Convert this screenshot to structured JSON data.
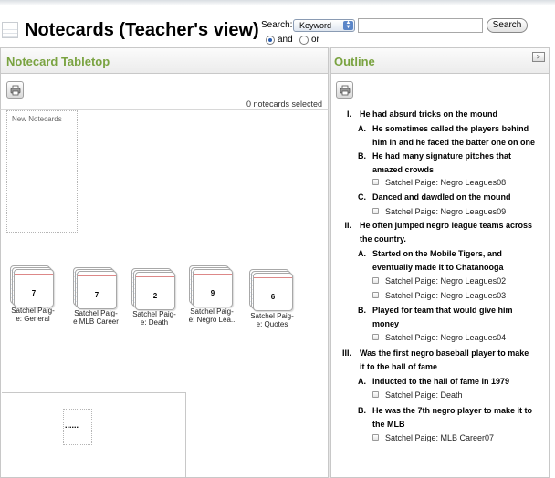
{
  "header": {
    "title": "Notecards (Teacher's view)"
  },
  "search": {
    "label": "Search:",
    "field_value": "Keyword",
    "input_value": "",
    "button_label": "Search",
    "mode_and": "and",
    "mode_or": "or",
    "selected_mode": "and"
  },
  "tabletop": {
    "title": "Notecard Tabletop",
    "selected_count": "0 notecards selected",
    "new_notecards_label": "New Notecards",
    "stacks": [
      {
        "count": "7",
        "caption_line1": "Satchel Paig-",
        "caption_line2": "e: General"
      },
      {
        "count": "7",
        "caption_line1": "Satchel Paig-",
        "caption_line2": "e MLB Career"
      },
      {
        "count": "2",
        "caption_line1": "Satchel Paig-",
        "caption_line2": "e: Death"
      },
      {
        "count": "9",
        "caption_line1": "Satchel Paig-",
        "caption_line2": "e: Negro Lea.."
      },
      {
        "count": "6",
        "caption_line1": "Satchel Paig-",
        "caption_line2": "e: Quotes"
      }
    ],
    "drop_placeholder": "......"
  },
  "outline": {
    "title": "Outline",
    "collapse_glyph": ">",
    "items": [
      {
        "num": "I.",
        "line1": "He had absurd tricks on the mound"
      },
      {
        "num": "A.",
        "line1": "He sometimes called the players behind",
        "line2": "him in and he faced the batter one on one"
      },
      {
        "num": "B.",
        "line1": "He had many signature pitches that",
        "line2": "amazed crowds"
      },
      {
        "note": "Satchel Paige: Negro Leagues08"
      },
      {
        "num": "C.",
        "line1": "Danced and dawdled on the mound"
      },
      {
        "note": "Satchel Paige: Negro Leagues09"
      },
      {
        "num": "II.",
        "line1": "He often jumped negro league teams across",
        "line2": "the country."
      },
      {
        "num": "A.",
        "line1": "Started on the Mobile Tigers, and",
        "line2": "eventually made it to Chatanooga"
      },
      {
        "note": "Satchel Paige: Negro Leagues02"
      },
      {
        "note": "Satchel Paige: Negro Leagues03"
      },
      {
        "num": "B.",
        "line1": "Played for team that would give him",
        "line2": "money"
      },
      {
        "note": "Satchel Paige: Negro Leagues04"
      },
      {
        "num": "III.",
        "line1": "Was the first negro baseball player to make",
        "line2": "it to the hall of fame"
      },
      {
        "num": "A.",
        "line1": "Inducted to the hall of fame in 1979"
      },
      {
        "note": "Satchel Paige: Death"
      },
      {
        "num": "B.",
        "line1": "He was the 7th negro player to make it to",
        "line2": "the MLB"
      },
      {
        "note": "Satchel Paige: MLB Career07"
      }
    ]
  }
}
